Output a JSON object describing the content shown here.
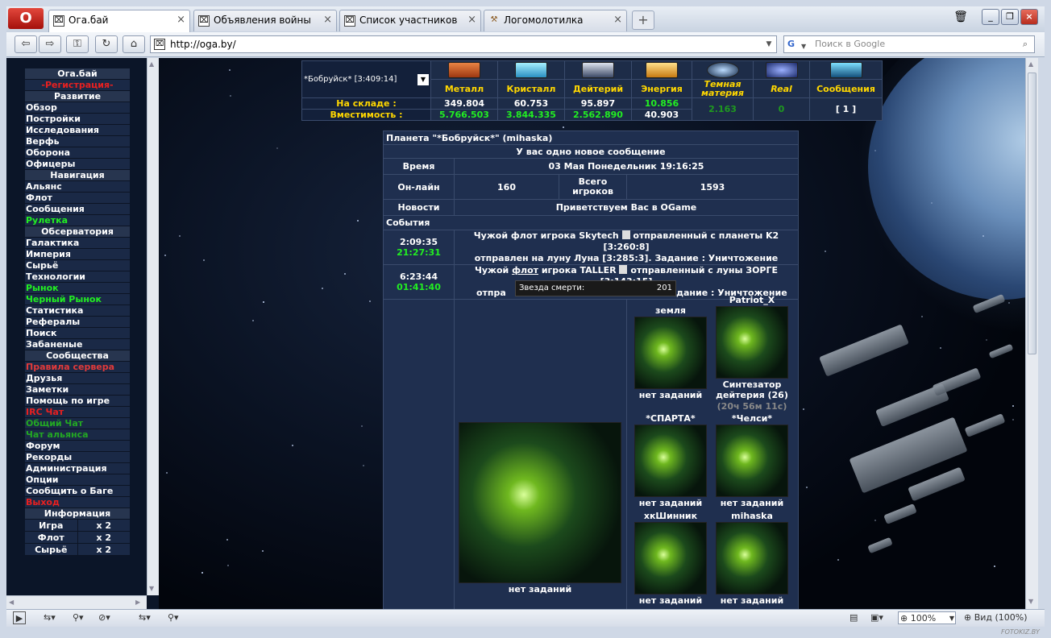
{
  "browser": {
    "tabs": [
      {
        "title": "Ога.бай",
        "active": true
      },
      {
        "title": "Объявления войны",
        "active": false
      },
      {
        "title": "Список участников",
        "active": false
      },
      {
        "title": "Логомолотилка",
        "active": false
      }
    ],
    "address": "http://oga.by/",
    "search_placeholder": "Поиск в Google",
    "zoom": "100%",
    "view_label": "Вид (100%)",
    "watermark": "FOTOKIZ.BY"
  },
  "menu": {
    "title": "Ога.бай",
    "subtitle": "-Регистрация-",
    "sections": [
      {
        "header": "Развитие",
        "items": [
          {
            "label": "Обзор",
            "color": "white"
          },
          {
            "label": "Постройки",
            "color": "white"
          },
          {
            "label": "Исследования",
            "color": "white"
          },
          {
            "label": "Верфь",
            "color": "white"
          },
          {
            "label": "Оборона",
            "color": "white"
          },
          {
            "label": "Офицеры",
            "color": "white"
          }
        ]
      },
      {
        "header": "Навигация",
        "items": [
          {
            "label": "Альянс",
            "color": "white"
          },
          {
            "label": "Флот",
            "color": "white"
          },
          {
            "label": "Сообщения",
            "color": "white"
          },
          {
            "label": "Рулетка",
            "color": "green"
          }
        ]
      },
      {
        "header": "Обсерватория",
        "items": [
          {
            "label": "Галактика",
            "color": "white"
          },
          {
            "label": "Империя",
            "color": "white"
          },
          {
            "label": "Сырьё",
            "color": "white"
          },
          {
            "label": "Технологии",
            "color": "white"
          },
          {
            "label": "Рынок",
            "color": "green"
          },
          {
            "label": "Черный Рынок",
            "color": "green"
          },
          {
            "label": "Статистика",
            "color": "white"
          },
          {
            "label": "Рефералы",
            "color": "white"
          },
          {
            "label": "Поиск",
            "color": "white"
          },
          {
            "label": "Забаненые",
            "color": "white"
          }
        ]
      },
      {
        "header": "Сообщества",
        "items": [
          {
            "label": "Правила сервера",
            "color": "pink"
          },
          {
            "label": "Друзья",
            "color": "white"
          },
          {
            "label": "Заметки",
            "color": "white"
          },
          {
            "label": "Помощь по игре",
            "color": "white"
          },
          {
            "label": "IRC Чат",
            "color": "red"
          },
          {
            "label": "Общий Чат",
            "color": "dkgreen"
          },
          {
            "label": "Чат альянса",
            "color": "dkgreen"
          },
          {
            "label": "Форум",
            "color": "white"
          },
          {
            "label": "Рекорды",
            "color": "white"
          },
          {
            "label": "Администрация",
            "color": "white"
          },
          {
            "label": "Опции",
            "color": "white"
          },
          {
            "label": "Сообщить о Баге",
            "color": "white"
          },
          {
            "label": "Выход",
            "color": "red"
          }
        ]
      }
    ],
    "info_header": "Информация",
    "info_rows": [
      {
        "label": "Игра",
        "value": "x 2"
      },
      {
        "label": "Флот",
        "value": "x 2"
      },
      {
        "label": "Сырьё",
        "value": "x 2"
      }
    ]
  },
  "resources": {
    "planet_select": "*Бобруйск* [3:409:14]",
    "columns": [
      {
        "name": "Металл",
        "stock": "349.804",
        "capacity": "5.766.503",
        "stock_color": "#ffffff",
        "cap_color": "#22ee22",
        "icon": "metal-icon",
        "icon_color": "#d2602a"
      },
      {
        "name": "Кристалл",
        "stock": "60.753",
        "capacity": "3.844.335",
        "stock_color": "#ffffff",
        "cap_color": "#22ee22",
        "icon": "crystal-icon",
        "icon_color": "#5ad0ee"
      },
      {
        "name": "Дейтерий",
        "stock": "95.897",
        "capacity": "2.562.890",
        "stock_color": "#ffffff",
        "cap_color": "#22ee22",
        "icon": "deuterium-icon",
        "icon_color": "#aab4c8"
      },
      {
        "name": "Энергия",
        "stock": "10.856",
        "capacity": "40.903",
        "stock_color": "#22ee22",
        "cap_color": "#ffffff",
        "icon": "energy-icon",
        "icon_color": "#f0b030"
      }
    ],
    "dark_matter": {
      "name": "Темная материя",
      "value": "2.163"
    },
    "real": {
      "name": "Real",
      "value": "0"
    },
    "messages": {
      "name": "Сообщения",
      "value": "[ 1 ]"
    },
    "row_labels": {
      "stock": "На складе :",
      "capacity": "Вместимость :"
    }
  },
  "overview": {
    "planet_title": "Планета \"*Бобруйск*\" (mihaska)",
    "new_message": "У вас одно новое сообщение",
    "time_label": "Время",
    "time_value": "03 Мая Понедельник 19:16:25",
    "online_label": "Он-лайн",
    "online_value": "160",
    "total_label": "Всего игроков",
    "total_value": "1593",
    "news_label": "Новости",
    "news_value": "Приветствуем Вас в OGame",
    "events_label": "События",
    "events": [
      {
        "time": "2:09:35",
        "countdown": "21:27:31",
        "line1": "Чужой флот игрока Skytech",
        "line1b": "отправленный с планеты K2 [3:260:8]",
        "line2": "отправлен на луну Луна [3:285:3]. Задание : Уничтожение"
      },
      {
        "time": "6:23:44",
        "countdown": "01:41:40",
        "line1a": "Чужой",
        "link": "флот",
        "line1b": "игрока TALLER",
        "line1c": "отправленный с луны ЗОРГЕ [3:143:15]",
        "line2a": "отпра",
        "line2b": "Задание : Уничтожение"
      }
    ],
    "tooltip": {
      "label": "Звезда смерти:",
      "value": "201"
    },
    "main_planet_status": "нет заданий",
    "moons": [
      {
        "name": "земля",
        "status": "нет заданий"
      },
      {
        "name": "Patriot_X",
        "status": "Синтезатор дейтерия (26)",
        "sub": "(20ч 56м 11с)"
      },
      {
        "name": "*СПАРТА*",
        "status": "нет заданий"
      },
      {
        "name": "*Челси*",
        "status": "нет заданий"
      },
      {
        "name": "хкШинник",
        "status": "нет заданий"
      },
      {
        "name": "mihaska",
        "status": "нет заданий"
      }
    ]
  }
}
